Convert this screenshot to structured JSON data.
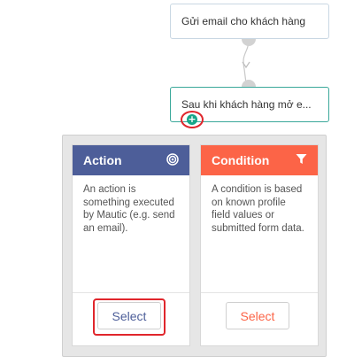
{
  "flow": {
    "email_node_label": "Gửi email cho khách hàng",
    "open_node_label": "Sau khi khách hàng mở e...",
    "add_button_symbol": "+"
  },
  "cards": {
    "action": {
      "title": "Action",
      "description": "An action is something executed by Mautic (e.g. send an email).",
      "select_label": "Select",
      "icon": "target-icon",
      "color": "#4d5e99"
    },
    "condition": {
      "title": "Condition",
      "description": "A condition is based on known profile field values or submitted form data.",
      "select_label": "Select",
      "icon": "filter-icon",
      "color": "#fc6447"
    }
  },
  "annotations": {
    "highlight_color": "#e0262c"
  }
}
